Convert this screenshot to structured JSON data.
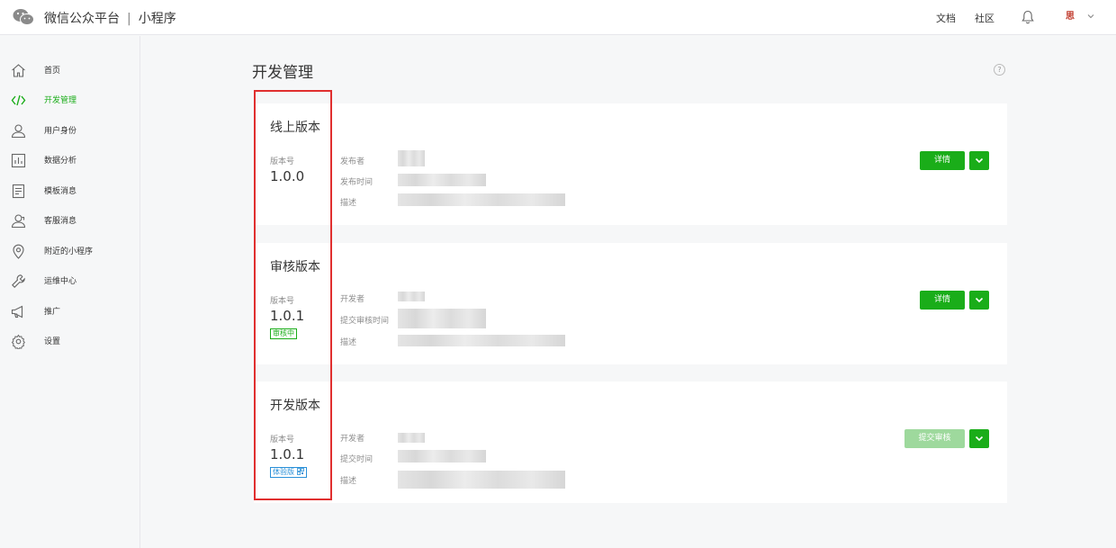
{
  "header": {
    "brand": "微信公众平台",
    "separator": "|",
    "product": "小程序",
    "docs": "文档",
    "community": "社区",
    "avatar_glyph": "思"
  },
  "sidebar": {
    "items": [
      {
        "label": "首页",
        "icon": "home-icon"
      },
      {
        "label": "开发管理",
        "icon": "code-icon",
        "active": true
      },
      {
        "label": "用户身份",
        "icon": "user-icon"
      },
      {
        "label": "数据分析",
        "icon": "chart-icon"
      },
      {
        "label": "模板消息",
        "icon": "document-icon"
      },
      {
        "label": "客服消息",
        "icon": "customer-service-icon"
      },
      {
        "label": "附近的小程序",
        "icon": "location-icon"
      },
      {
        "label": "运维中心",
        "icon": "wrench-icon"
      },
      {
        "label": "推广",
        "icon": "megaphone-icon"
      },
      {
        "label": "设置",
        "icon": "gear-icon"
      }
    ]
  },
  "main": {
    "title": "开发管理",
    "help_glyph": "?",
    "cards": [
      {
        "title": "线上版本",
        "version_label": "版本号",
        "version": "1.0.0",
        "badge": "",
        "fields": [
          "发布者",
          "发布时间",
          "描述"
        ],
        "action": "详情"
      },
      {
        "title": "审核版本",
        "version_label": "版本号",
        "version": "1.0.1",
        "badge": "审核中",
        "fields": [
          "开发者",
          "提交审核时间",
          "描述"
        ],
        "action": "详情"
      },
      {
        "title": "开发版本",
        "version_label": "版本号",
        "version": "1.0.1",
        "badge": "体验版",
        "fields": [
          "开发者",
          "提交时间",
          "描述"
        ],
        "action": "提交审核"
      }
    ]
  },
  "colors": {
    "accent": "#1aad19",
    "accent_disabled": "#9ed99d",
    "highlight": "#e02f2f",
    "badge_blue": "#2a90d8"
  }
}
